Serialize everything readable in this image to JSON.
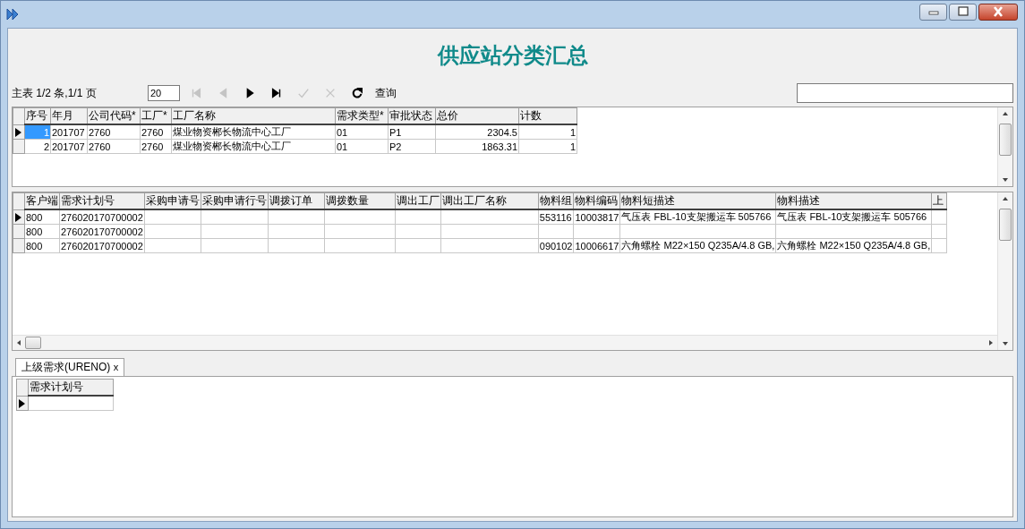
{
  "window": {
    "title": "供应站分类汇总"
  },
  "toolbar": {
    "page_info": "主表 1/2 条,1/1 页",
    "page_size": "20",
    "buttons": [
      {
        "kind": "first",
        "disabled": true
      },
      {
        "kind": "prev",
        "disabled": true
      },
      {
        "kind": "next",
        "disabled": false
      },
      {
        "kind": "last",
        "disabled": false
      },
      {
        "kind": "confirm",
        "disabled": true
      },
      {
        "kind": "cancel",
        "disabled": true
      },
      {
        "kind": "refresh",
        "disabled": false
      }
    ],
    "query_label": "查询"
  },
  "master_table": {
    "columns": [
      "序号",
      "年月",
      "公司代码*",
      "工厂*",
      "工厂名称",
      "需求类型*",
      "审批状态",
      "总价",
      "计数"
    ],
    "rows": [
      {
        "selected": true,
        "cells": [
          "1",
          "201707",
          "2760",
          "2760",
          "煤业物资郴长物流中心工厂",
          "01",
          "P1",
          "2304.5",
          "1"
        ]
      },
      {
        "selected": false,
        "cells": [
          "2",
          "201707",
          "2760",
          "2760",
          "煤业物资郴长物流中心工厂",
          "01",
          "P2",
          "1863.31",
          "1"
        ]
      }
    ]
  },
  "detail_table": {
    "columns": [
      "客户端",
      "需求计划号",
      "采购申请号",
      "采购申请行号",
      "调拨订单",
      "调拨数量",
      "调出工厂",
      "调出工厂名称",
      "物料组",
      "物料编码",
      "物料短描述",
      "物料描述",
      "上"
    ],
    "rows": [
      {
        "selected": true,
        "cells": [
          "800",
          "276020170700002",
          "",
          "",
          "",
          "",
          "",
          "",
          "553116",
          "10003817",
          "气压表 FBL-10支架搬运车 505766",
          "气压表 FBL-10支架搬运车 505766",
          ""
        ]
      },
      {
        "selected": false,
        "cells": [
          "800",
          "276020170700002",
          "",
          "",
          "",
          "",
          "",
          "",
          "",
          "",
          "",
          "",
          ""
        ]
      },
      {
        "selected": false,
        "cells": [
          "800",
          "276020170700002",
          "",
          "",
          "",
          "",
          "",
          "",
          "090102",
          "10006617",
          "六角螺栓 M22×150 Q235A/4.8 GB,",
          "六角螺栓 M22×150 Q235A/4.8 GB,",
          ""
        ]
      }
    ]
  },
  "tabs": [
    {
      "label": "上级需求(URENO)",
      "close": "x",
      "selected": true
    }
  ],
  "sub_table": {
    "columns": [
      "需求计划号"
    ],
    "rows": [
      {
        "selected": true,
        "cells": [
          ""
        ]
      }
    ]
  }
}
